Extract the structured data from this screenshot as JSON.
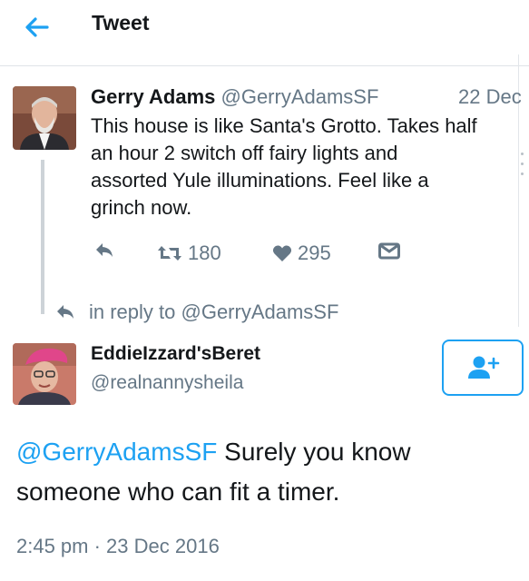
{
  "header": {
    "title": "Tweet",
    "back_icon": "arrow-left-icon"
  },
  "tweet": {
    "author_name": "Gerry Adams",
    "author_handle": "@GerryAdamsSF",
    "date": "22 Dec",
    "text_lines": [
      "This house is like Santa's Grotto. Takes half",
      "an hour 2 switch off fairy lights and",
      "assorted Yule illuminations. Feel like a",
      "grinch now."
    ],
    "actions": {
      "reply_icon": "reply-icon",
      "retweet_icon": "retweet-icon",
      "retweet_count": "180",
      "like_icon": "heart-icon",
      "like_count": "295",
      "dm_icon": "direct-message-icon"
    }
  },
  "reply": {
    "reply_to_text": "in reply to @GerryAdamsSF",
    "author_name": "EddieIzzard'sBeret",
    "author_handle": "@realnannysheila",
    "follow_icon": "add-user-icon",
    "mention": "@GerryAdamsSF",
    "text_line1_rest": " Surely you know",
    "text_line2": "someone who can fit a timer.",
    "timestamp": "2:45 pm · 23 Dec 2016"
  },
  "colors": {
    "accent": "#1da1f2",
    "secondary_text": "#657786",
    "primary_text": "#14171a",
    "like": "#657786"
  }
}
